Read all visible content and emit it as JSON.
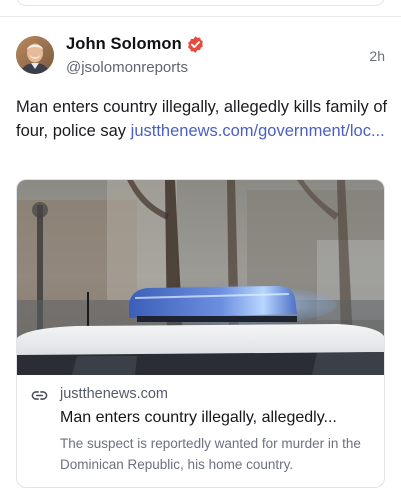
{
  "post": {
    "author": {
      "name": "John Solomon",
      "handle": "@jsolomonreports",
      "verified": true,
      "verified_color": "#ec4a3c"
    },
    "timestamp": "2h",
    "text": "Man enters country illegally, allegedly kills family of four, police say ",
    "text_link": "justthenews.com/government/loc...",
    "link_color": "#4a5fc1",
    "card": {
      "image_icon": "police-light-bar-photo",
      "domain_icon": "link-icon",
      "domain": "justthenews.com",
      "title": "Man enters country illegally, allegedly...",
      "description": "The suspect is reportedly wanted for murder in the Dominican Republic, his home country."
    }
  }
}
